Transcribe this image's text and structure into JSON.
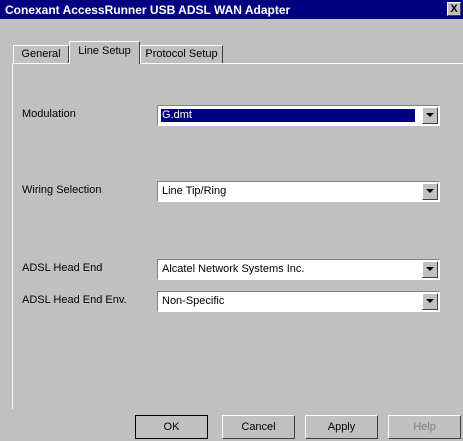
{
  "window": {
    "title": "Conexant AccessRunner USB ADSL WAN Adapter",
    "close_glyph": "X"
  },
  "tabs": [
    {
      "label": "General"
    },
    {
      "label": "Line Setup",
      "active": true
    },
    {
      "label": "Protocol Setup"
    }
  ],
  "form": {
    "modulation": {
      "label": "Modulation",
      "value": "G.dmt"
    },
    "wiring": {
      "label": "Wiring Selection",
      "value": "Line Tip/Ring"
    },
    "head_end": {
      "label": "ADSL Head End",
      "value": "Alcatel Network Systems Inc."
    },
    "head_end_env": {
      "label": "ADSL Head End Env.",
      "value": "Non-Specific"
    }
  },
  "buttons": {
    "ok": "OK",
    "cancel": "Cancel",
    "apply": "Apply",
    "help": "Help"
  },
  "colors": {
    "titlebar": "#000080",
    "face": "#c0c0c0",
    "selection": "#000080"
  }
}
